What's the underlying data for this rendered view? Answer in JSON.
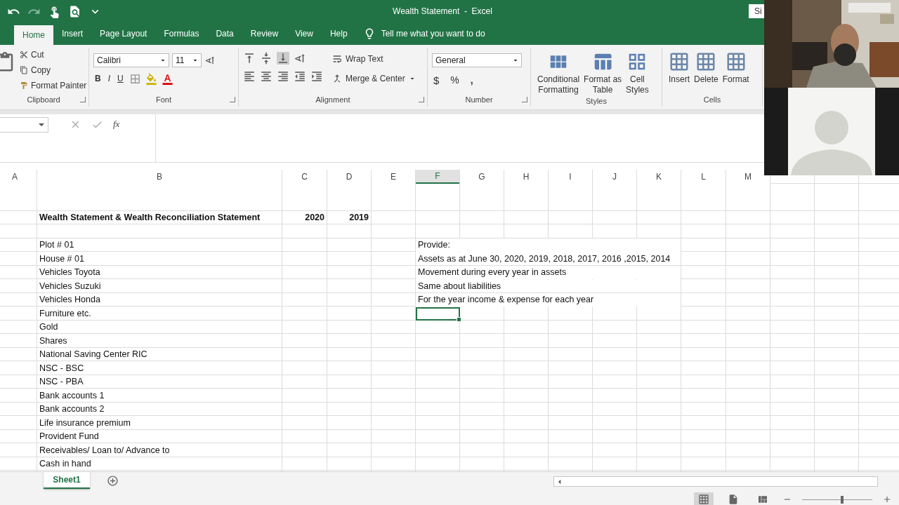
{
  "window": {
    "title": "Wealth Statement  -  Excel",
    "sign_in": "Si"
  },
  "tabs": [
    {
      "label": "Home",
      "selected": true
    },
    {
      "label": "Insert",
      "selected": false
    },
    {
      "label": "Page Layout",
      "selected": false
    },
    {
      "label": "Formulas",
      "selected": false
    },
    {
      "label": "Data",
      "selected": false
    },
    {
      "label": "Review",
      "selected": false
    },
    {
      "label": "View",
      "selected": false
    },
    {
      "label": "Help",
      "selected": false
    }
  ],
  "tell_me": "Tell me what you want to do",
  "ribbon": {
    "clipboard": {
      "cut": "Cut",
      "copy": "Copy",
      "format_painter": "Format Painter",
      "label": "Clipboard"
    },
    "font": {
      "name": "Calibri",
      "size": "11",
      "bold": "B",
      "italic": "I",
      "underline": "U",
      "label": "Font"
    },
    "alignment": {
      "wrap": "Wrap Text",
      "merge": "Merge & Center",
      "label": "Alignment"
    },
    "number": {
      "format": "General",
      "currency": "$",
      "percent": "%",
      "comma": ",",
      "label": "Number"
    },
    "styles": {
      "buttons": [
        {
          "line1": "Conditional",
          "line2": "Formatting"
        },
        {
          "line1": "Format as",
          "line2": "Table"
        },
        {
          "line1": "Cell",
          "line2": "Styles"
        }
      ],
      "label": "Styles"
    },
    "cells": {
      "buttons": [
        "Insert",
        "Delete",
        "Format"
      ],
      "label": "Cells"
    }
  },
  "formula_bar": {
    "fx": "fx"
  },
  "columns": [
    {
      "label": "A",
      "selected": false
    },
    {
      "label": "B",
      "selected": false
    },
    {
      "label": "C",
      "selected": false
    },
    {
      "label": "D",
      "selected": false
    },
    {
      "label": "E",
      "selected": false
    },
    {
      "label": "F",
      "selected": true
    },
    {
      "label": "G",
      "selected": false
    },
    {
      "label": "H",
      "selected": false
    },
    {
      "label": "I",
      "selected": false
    },
    {
      "label": "J",
      "selected": false
    },
    {
      "label": "K",
      "selected": false
    },
    {
      "label": "L",
      "selected": false
    },
    {
      "label": "M",
      "selected": false
    }
  ],
  "rows": [
    {},
    {},
    {
      "bold": true,
      "item": "Wealth Statement & Wealth Reconciliation Statement",
      "year_1": "2020",
      "year_2": "2019"
    },
    {},
    {
      "item": "Plot # 01",
      "note": "Provide:"
    },
    {
      "item": "House # 01",
      "note": "Assets as at June 30, 2020, 2019, 2018, 2017, 2016 ,2015, 2014"
    },
    {
      "item": "Vehicles Toyota",
      "note": "Movement during every year in assets"
    },
    {
      "item": "Vehicles Suzuki",
      "note": "Same about liabilities"
    },
    {
      "item": "Vehicles Honda",
      "note": "For the year income & expense for each year"
    },
    {
      "item": "Furniture etc.",
      "note_cell_active": true
    },
    {
      "item": "Gold"
    },
    {
      "item": "Shares"
    },
    {
      "item": "National Saving Center RIC"
    },
    {
      "item": "NSC - BSC"
    },
    {
      "item": "NSC - PBA"
    },
    {
      "item": "Bank accounts 1"
    },
    {
      "item": "Bank accounts 2"
    },
    {
      "item": "Life insurance premium"
    },
    {
      "item": "Provident Fund"
    },
    {
      "item": "Receivables/ Loan to/ Advance to"
    },
    {
      "item": "Cash in hand"
    }
  ],
  "sheets": [
    {
      "label": "Sheet1",
      "selected": true
    }
  ],
  "zoom": {
    "level": 0.55
  },
  "video_call": {
    "tiles": [
      {
        "kind": "picture"
      },
      {
        "kind": "avatar"
      }
    ]
  }
}
